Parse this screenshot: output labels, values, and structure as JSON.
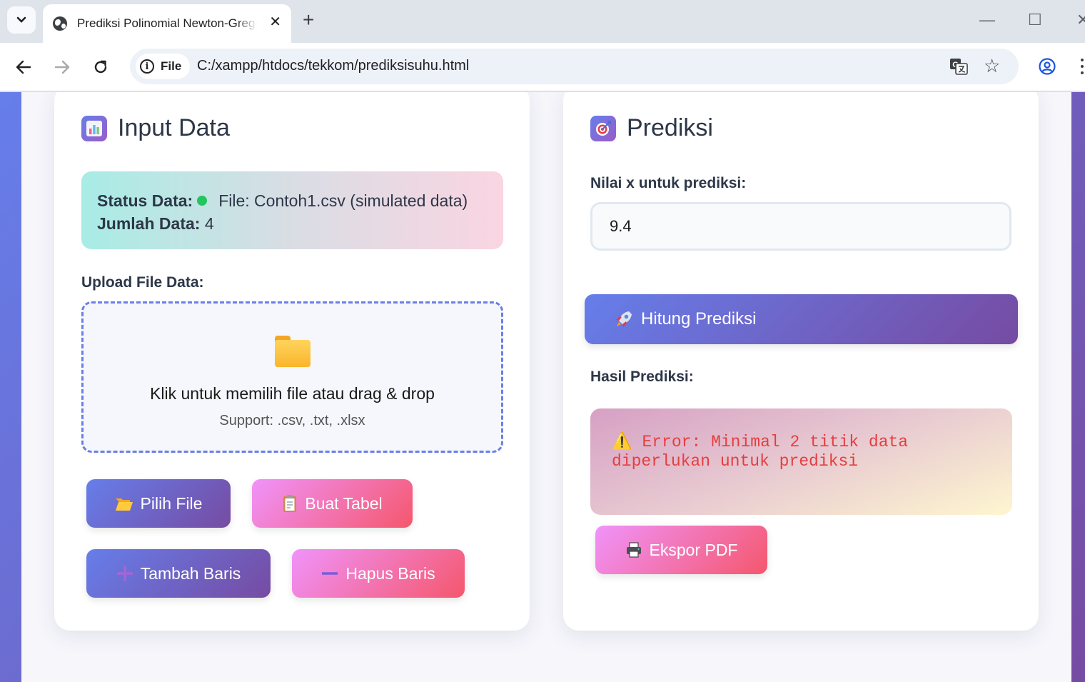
{
  "browser": {
    "tab_title": "Prediksi Polinomial Newton-Gregory",
    "tab_close": "✕",
    "new_tab": "+",
    "site_chip_label": "File",
    "url": "C:/xampp/htdocs/tekkom/prediksisuhu.html",
    "window_minimize": "—",
    "window_maximize": "☐",
    "window_close": "✕"
  },
  "input_panel": {
    "icon": "bar-chart-icon",
    "title": "Input Data",
    "status": {
      "status_label": "Status Data:",
      "status_value": "File: Contoh1.csv (simulated data)",
      "status_color": "#22c55e",
      "count_label": "Jumlah Data:",
      "count_value": "4"
    },
    "upload_label": "Upload File Data:",
    "upload_zone": {
      "icon": "folder-icon",
      "main_text": "Klik untuk memilih file atau drag & drop",
      "support_text": "Support: .csv, .txt, .xlsx"
    },
    "buttons": {
      "pilih_file": "Pilih File",
      "buat_tabel": "Buat Tabel",
      "tambah_baris": "Tambah Baris",
      "hapus_baris": "Hapus Baris"
    }
  },
  "prediction_panel": {
    "icon": "target-icon",
    "title": "Prediksi",
    "x_label": "Nilai x untuk prediksi:",
    "x_value": "9.4",
    "hitung_button": "Hitung Prediksi",
    "result_label": "Hasil Prediksi:",
    "result_text": "Error: Minimal 2 titik data diperlukan untuk prediksi",
    "result_icon": "warning-icon",
    "ekspor_button": "Ekspor PDF"
  },
  "colors": {
    "accent_purple_start": "#667eea",
    "accent_purple_end": "#764ba2",
    "accent_pink_start": "#f093fb",
    "accent_pink_end": "#f5576c",
    "error_text": "#e53e3e"
  }
}
